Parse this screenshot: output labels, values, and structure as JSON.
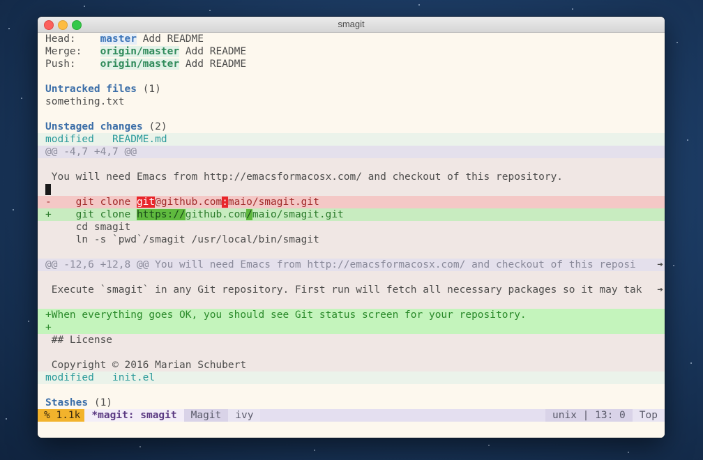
{
  "window": {
    "title": "smagit"
  },
  "header": [
    {
      "label": "Head:    ",
      "branch": "master",
      "branch_kind": "local",
      "message": "Add README"
    },
    {
      "label": "Merge:   ",
      "branch": "origin/master",
      "branch_kind": "remote",
      "message": "Add README"
    },
    {
      "label": "Push:    ",
      "branch": "origin/master",
      "branch_kind": "remote",
      "message": "Add README"
    }
  ],
  "untracked": {
    "title": "Untracked files",
    "count": "(1)",
    "files": [
      "something.txt"
    ]
  },
  "unstaged": {
    "title": "Unstaged changes",
    "count": "(2)",
    "file1_label": "modified   README.md",
    "hunk1_header": "@@ -4,7 +4,7 @@",
    "ctx_line1": " You will need Emacs from http://emacsformacosx.com/ and checkout of this repository.",
    "del_prefix": "-    git clone ",
    "del_hl1": "git",
    "del_mid": "@github.com",
    "del_hl2": ":",
    "del_suffix": "maio/smagit.git",
    "add_prefix": "+    git clone ",
    "add_hl1": "https://",
    "add_mid": "github.com",
    "add_hl2": "/",
    "add_suffix": "maio/smagit.git",
    "ctx_cd": "     cd smagit",
    "ctx_ln": "     ln -s `pwd`/smagit /usr/local/bin/smagit",
    "hunk2_header": "@@ -12,6 +12,8 @@ You will need Emacs from http://emacsformacosx.com/ and checkout of this reposi",
    "ctx_execute": " Execute `smagit` in any Git repository. First run will fetch all necessary packages so it may tak",
    "add_line1": "+When everything goes OK, you should see Git status screen for your repository.",
    "add_line2": "+",
    "ctx_license": " ## License",
    "ctx_copyright": " Copyright © 2016 Marian Schubert",
    "file2_label": "modified   init.el"
  },
  "stashes": {
    "title": "Stashes",
    "count": "(1)"
  },
  "wrap_arrow": "➔",
  "modeline": {
    "position": "% 1.1k",
    "buffer": "*magit: smagit",
    "major_mode": "Magit",
    "minor_mode": "ivy",
    "encoding": "unix | 13: 0",
    "scroll": "Top"
  },
  "colors": {
    "accent_section": "#3b6ea8",
    "local_branch": "#3b74b8",
    "remote_branch": "#2f8a5a",
    "deletion": "#f4c8c6",
    "addition": "#c8ecc0",
    "modeline_position": "#f2b32c"
  }
}
